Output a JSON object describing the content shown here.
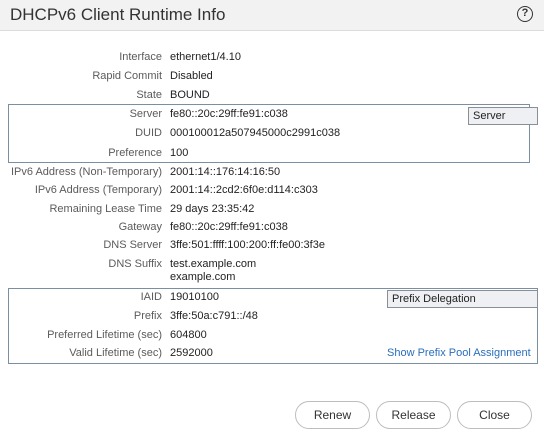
{
  "dialog": {
    "title": "DHCPv6 Client Runtime Info",
    "help_icon": "?"
  },
  "general": [
    {
      "label": "Interface",
      "value": "ethernet1/4.10"
    },
    {
      "label": "Rapid Commit",
      "value": "Disabled"
    },
    {
      "label": "State",
      "value": "BOUND"
    }
  ],
  "server_group": {
    "title": "Server",
    "rows": [
      {
        "label": "Server",
        "value": "fe80::20c:29ff:fe91:c038"
      },
      {
        "label": "DUID",
        "value": "000100012a507945000c2991c038"
      },
      {
        "label": "Preference",
        "value": "100"
      }
    ]
  },
  "address_info": [
    {
      "label": "IPv6 Address (Non-Temporary)",
      "value": "2001:14::176:14:16:50"
    },
    {
      "label": "IPv6 Address (Temporary)",
      "value": "2001:14::2cd2:6f0e:d114:c303"
    },
    {
      "label": "Remaining Lease Time",
      "value": "29 days 23:35:42"
    },
    {
      "label": "Gateway",
      "value": "fe80::20c:29ff:fe91:c038"
    },
    {
      "label": "DNS Server",
      "value": "3ffe:501:ffff:100:200:ff:fe00:3f3e"
    }
  ],
  "dns_suffix": {
    "label": "DNS Suffix",
    "values": [
      "test.example.com",
      "example.com"
    ]
  },
  "prefix_group": {
    "title": "Prefix Delegation",
    "rows": [
      {
        "label": "IAID",
        "value": "19010100"
      },
      {
        "label": "Prefix",
        "value": "3ffe:50a:c791::/48"
      },
      {
        "label": "Preferred Lifetime (sec)",
        "value": "604800"
      },
      {
        "label": "Valid Lifetime (sec)",
        "value": "2592000"
      }
    ],
    "link": "Show Prefix Pool Assignment"
  },
  "buttons": {
    "renew": "Renew",
    "release": "Release",
    "close": "Close"
  }
}
